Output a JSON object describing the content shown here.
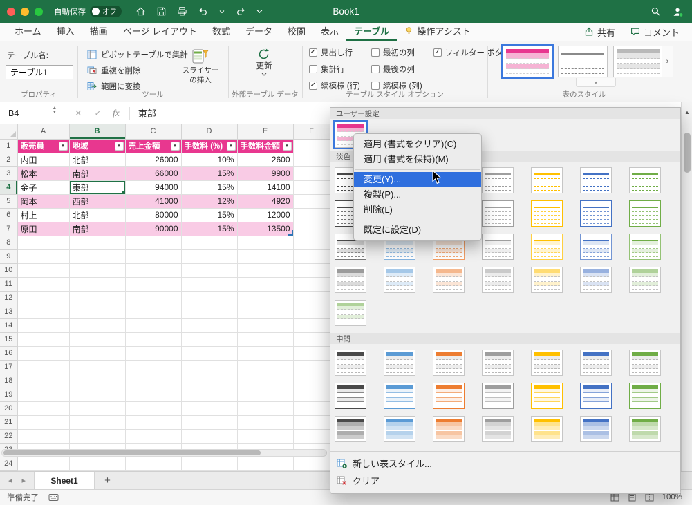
{
  "colors": {
    "titlebar": "#1F7145",
    "accent": "#1E7044",
    "table_header": "#E8378F",
    "table_band": "#F9CBE5",
    "menu_highlight": "#2F6FDE"
  },
  "titlebar": {
    "autosave_label": "自動保存",
    "autosave_state": "オフ",
    "title": "Book1"
  },
  "ribbon_tabs": {
    "items": [
      {
        "label": "ホーム"
      },
      {
        "label": "挿入"
      },
      {
        "label": "描画"
      },
      {
        "label": "ページ レイアウト"
      },
      {
        "label": "数式"
      },
      {
        "label": "データ"
      },
      {
        "label": "校閲"
      },
      {
        "label": "表示"
      },
      {
        "label": "テーブル",
        "active": true
      },
      {
        "label": "操作アシスト",
        "bulb": true
      }
    ],
    "share_label": "共有",
    "comments_label": "コメント"
  },
  "ribbon": {
    "properties": {
      "name_label": "テーブル名:",
      "name_value": "テーブル1",
      "group": "プロパティ"
    },
    "tools": {
      "pivot": "ピボットテーブルで集計",
      "dedupe": "重複を削除",
      "convert": "範囲に変換",
      "slicer_line1": "スライサー",
      "slicer_line2": "の挿入",
      "group": "ツール"
    },
    "external": {
      "refresh": "更新",
      "group": "外部テーブル データ"
    },
    "options": {
      "group": "テーブル スタイル オプション",
      "checks": [
        {
          "label": "見出し行",
          "checked": true
        },
        {
          "label": "集計行",
          "checked": false
        },
        {
          "label": "縞模様 (行)",
          "checked": true
        },
        {
          "label": "最初の列",
          "checked": false
        },
        {
          "label": "最後の列",
          "checked": false
        },
        {
          "label": "縞模様 (列)",
          "checked": false
        },
        {
          "label": "フィルター ボタン",
          "checked": true
        }
      ]
    },
    "styles": {
      "group": "表のスタイル",
      "gallery": [
        {
          "color": "#E8378F",
          "kind": "custom",
          "selected": true
        },
        {
          "color": "#8A8A8A",
          "kind": "lines"
        },
        {
          "color": "#7F7F7F",
          "kind": "banded"
        }
      ]
    }
  },
  "formula_bar": {
    "cell_ref": "B4",
    "value": "東部"
  },
  "grid": {
    "columns": [
      "A",
      "B",
      "C",
      "D",
      "E",
      "F"
    ],
    "rows": 24,
    "selected": {
      "col": "B",
      "row": 4
    }
  },
  "table": {
    "headers": [
      "販売員",
      "地域",
      "売上金額",
      "手数料 (%)",
      "手数料金額"
    ],
    "rows": [
      [
        "内田",
        "北部",
        "26000",
        "10%",
        "2600"
      ],
      [
        "松本",
        "南部",
        "66000",
        "15%",
        "9900"
      ],
      [
        "金子",
        "東部",
        "94000",
        "15%",
        "14100"
      ],
      [
        "岡本",
        "西部",
        "41000",
        "12%",
        "4920"
      ],
      [
        "村上",
        "北部",
        "80000",
        "15%",
        "12000"
      ],
      [
        "原田",
        "南部",
        "90000",
        "15%",
        "13500"
      ]
    ]
  },
  "styles_panel": {
    "custom_section": "ユーザー設定",
    "light_section": "淡色",
    "medium_section": "中間",
    "new_style_label": "新しい表スタイル...",
    "clear_label": "クリア",
    "palette": [
      "#4A4A4A",
      "#5B9BD5",
      "#ED7D31",
      "#9E9E9E",
      "#FFC000",
      "#4472C4",
      "#70AD47"
    ],
    "custom_tile": {
      "color": "#E8378F",
      "kind": "custom",
      "selected": true
    },
    "light_row_kinds": [
      "lines",
      "bordered",
      "banded-light",
      "banded"
    ],
    "light_extra_tile": {
      "color": "#70AD47",
      "kind": "banded"
    },
    "medium_row_kinds": [
      "dark-header",
      "grid",
      "solid"
    ]
  },
  "context_menu": {
    "items": [
      {
        "label": "適用 (書式をクリア)(C)"
      },
      {
        "label": "適用 (書式を保持)(M)",
        "sep_after": true
      },
      {
        "label": "変更(Y)...",
        "highlight": true
      },
      {
        "label": "複製(P)..."
      },
      {
        "label": "削除(L)",
        "sep_after": true
      },
      {
        "label": "既定に設定(D)"
      }
    ]
  },
  "sheet_tabs": {
    "name": "Sheet1",
    "add_label": "+"
  },
  "status": {
    "ready": "準備完了",
    "zoom": "100%"
  }
}
